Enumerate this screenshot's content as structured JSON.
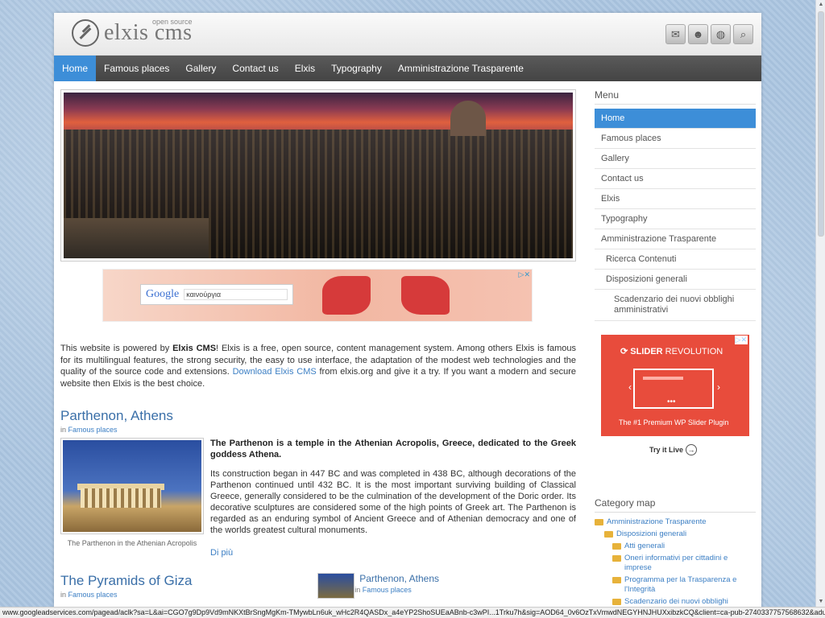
{
  "site": {
    "logo_text": "elxis cms",
    "logo_sub": "open source"
  },
  "header_icons": [
    "mail-icon",
    "user-icon",
    "globe-icon",
    "search-icon"
  ],
  "nav": [
    "Home",
    "Famous places",
    "Gallery",
    "Contact us",
    "Elxis",
    "Typography",
    "Amministrazione Trasparente"
  ],
  "ad1": {
    "choices": "▷✕",
    "brand": "Google",
    "query": "καινούργια"
  },
  "intro": {
    "prefix": "This website is powered by ",
    "bold": "Elxis CMS",
    "mid": "! Elxis is a free, open source, content management system. Among others Elxis is famous for its multilingual features, the strong security, the easy to use interface, the adaptation of the modest web technologies and the quality of the source code and extensions. ",
    "link": "Download Elxis CMS",
    "suffix": " from elxis.org and give it a try. If you want a modern and secure website then Elxis is the best choice."
  },
  "article1": {
    "title": "Parthenon, Athens",
    "in": "in",
    "category": "Famous places",
    "lead": "The Parthenon is a temple in the Athenian Acropolis, Greece, dedicated to the Greek goddess Athena.",
    "body": "Its construction began in 447 BC and was completed in 438 BC, although decorations of the Parthenon continued until 432 BC. It is the most important surviving building of Classical Greece, generally considered to be the culmination of the development of the Doric order. Its decorative sculptures are considered some of the high points of Greek art. The Parthenon is regarded as an enduring symbol of Ancient Greece and of Athenian democracy and one of the worlds greatest cultural monuments.",
    "caption": "The Parthenon in the Athenian Acropolis",
    "more": "Di più"
  },
  "article2": {
    "title": "The Pyramids of Giza",
    "in": "in",
    "category": "Famous places"
  },
  "mini_article": {
    "title": "Parthenon, Athens",
    "in": "in",
    "category": "Famous places"
  },
  "side": {
    "menu_title": "Menu",
    "menu": [
      {
        "label": "Home",
        "level": 0
      },
      {
        "label": "Famous places",
        "level": 0
      },
      {
        "label": "Gallery",
        "level": 0
      },
      {
        "label": "Contact us",
        "level": 0
      },
      {
        "label": "Elxis",
        "level": 0
      },
      {
        "label": "Typography",
        "level": 0
      },
      {
        "label": "Amministrazione Trasparente",
        "level": 0
      },
      {
        "label": "Ricerca Contenuti",
        "level": 1
      },
      {
        "label": "Disposizioni generali",
        "level": 1
      },
      {
        "label": "Scadenzario dei nuovi obblighi amministrativi",
        "level": 2
      }
    ],
    "ad2": {
      "choices": "▷✕",
      "title_bold": "SLIDER",
      "title_rest": " REVOLUTION",
      "tagline": "The #1 Premium WP Slider Plugin",
      "try": "Try it Live"
    },
    "catmap_title": "Category map",
    "catmap": [
      {
        "label": "Amministrazione Trasparente",
        "level": 1
      },
      {
        "label": "Disposizioni generali",
        "level": 2
      },
      {
        "label": "Atti generali",
        "level": 3
      },
      {
        "label": "Oneri informativi per cittadini e imprese",
        "level": 3
      },
      {
        "label": "Programma per la Trasparenza e l'Integrità",
        "level": 3
      },
      {
        "label": "Scadenzario dei nuovi obblighi amministrativi",
        "level": 3
      }
    ]
  },
  "status_url": "www.googleadservices.com/pagead/aclk?sa=L&ai=CGO7g9Dp9Vd9mNKXtBrSngMgKm-TMywbLn6uk_wHc2R4QASDx_a4eYP2ShoSUEaABnb-c3wPI...1Trku7h&sig=AOD64_0v6OzTxVmwdNEGYHNJHUXxibzkCQ&client=ca-pub-2740337757568632&adurl=http://revolution.themepunch.com/"
}
